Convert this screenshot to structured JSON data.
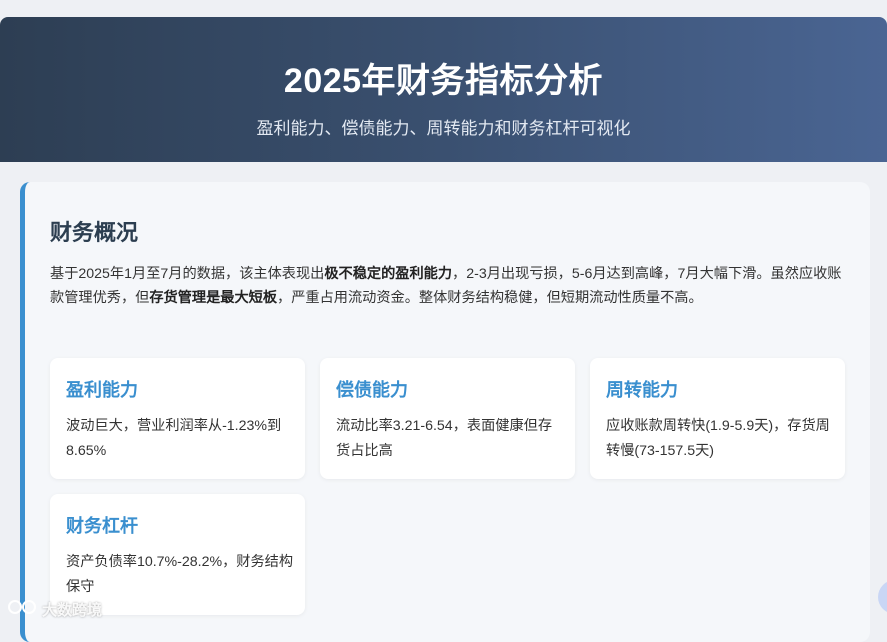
{
  "header": {
    "title": "2025年财务指标分析",
    "subtitle": "盈利能力、偿债能力、周转能力和财务杠杆可视化"
  },
  "overview": {
    "title": "财务概况",
    "desc_1": "基于2025年1月至7月的数据，该主体表现出",
    "desc_bold_1": "极不稳定的盈利能力",
    "desc_2": "，2-3月出现亏损，5-6月达到高峰，7月大幅下滑。虽然应收账款管理优秀，但",
    "desc_bold_2": "存货管理是最大短板",
    "desc_3": "，严重占用流动资金。整体财务结构稳健，但短期流动性质量不高。"
  },
  "cards": [
    {
      "title": "盈利能力",
      "text": "波动巨大，营业利润率从-1.23%到8.65%"
    },
    {
      "title": "偿债能力",
      "text": "流动比率3.21-6.54，表面健康但存货占比高"
    },
    {
      "title": "周转能力",
      "text": "应收账款周转快(1.9-5.9天)，存货周转慢(73-157.5天)"
    },
    {
      "title": "财务杠杆",
      "text": "资产负债率10.7%-28.2%，财务结构保守"
    }
  ],
  "watermark": {
    "icon": "kk-logo-icon",
    "text": "大数跨境"
  }
}
